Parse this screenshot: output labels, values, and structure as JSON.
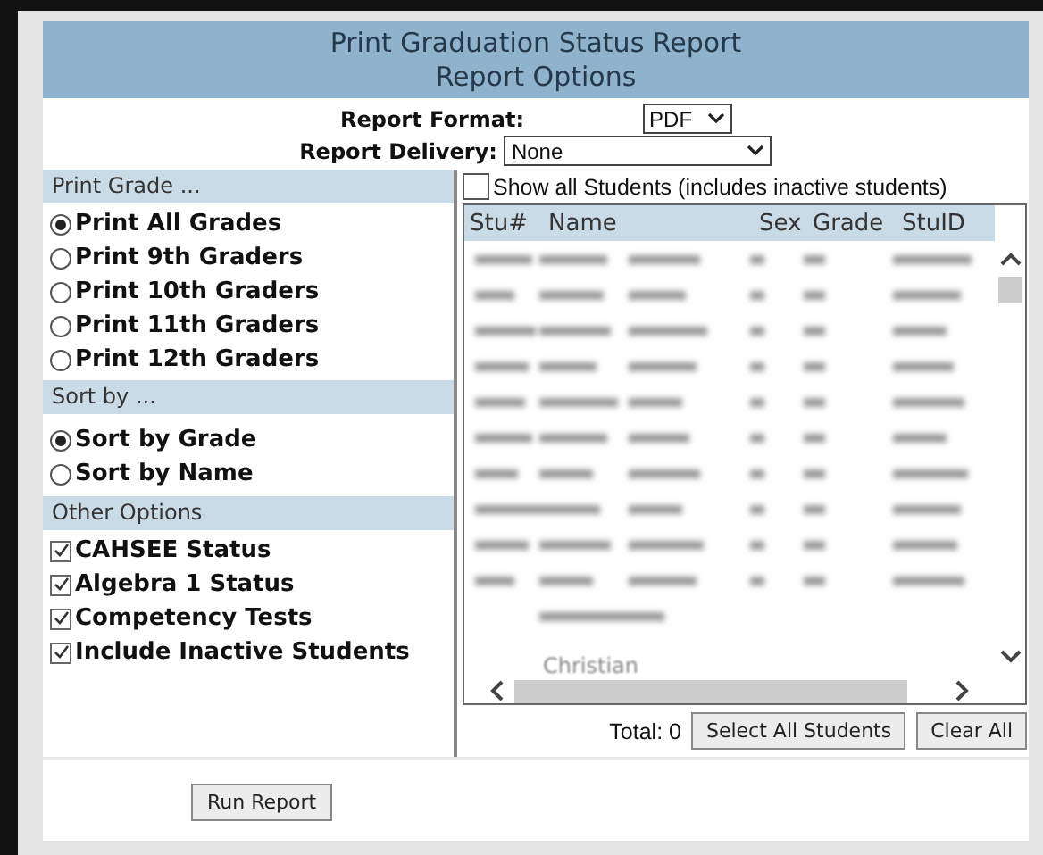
{
  "header": {
    "title": "Print Graduation Status Report",
    "subtitle": "Report Options"
  },
  "report_format": {
    "label": "Report Format:",
    "value": "PDF"
  },
  "report_delivery": {
    "label": "Report Delivery:",
    "value": "None"
  },
  "sections": [
    {
      "title": "Print Grade ...",
      "kind": "radio",
      "items": [
        {
          "label": "Print All Grades",
          "selected": true
        },
        {
          "label": "Print 9th Graders",
          "selected": false
        },
        {
          "label": "Print 10th Graders",
          "selected": false
        },
        {
          "label": "Print 11th Graders",
          "selected": false
        },
        {
          "label": "Print 12th Graders",
          "selected": false
        }
      ]
    },
    {
      "title": "Sort by ...",
      "kind": "radio",
      "items": [
        {
          "label": "Sort by Grade",
          "selected": true
        },
        {
          "label": "Sort by Name",
          "selected": false
        }
      ]
    },
    {
      "title": "Other Options",
      "kind": "checkbox",
      "items": [
        {
          "label": "CAHSEE Status",
          "checked": true
        },
        {
          "label": "Algebra 1 Status",
          "checked": true
        },
        {
          "label": "Competency Tests",
          "checked": true
        },
        {
          "label": "Include Inactive Students",
          "checked": true
        }
      ]
    }
  ],
  "show_all": {
    "label": "Show all Students (includes inactive students)",
    "checked": false
  },
  "student_table": {
    "columns": [
      "Stu#",
      "Name",
      "Sex",
      "Grade",
      "StuID"
    ],
    "partial_text": "Christian"
  },
  "total": "Total: 0",
  "buttons": [
    "Select All Students",
    "Clear All"
  ],
  "run_button": "Run Report"
}
